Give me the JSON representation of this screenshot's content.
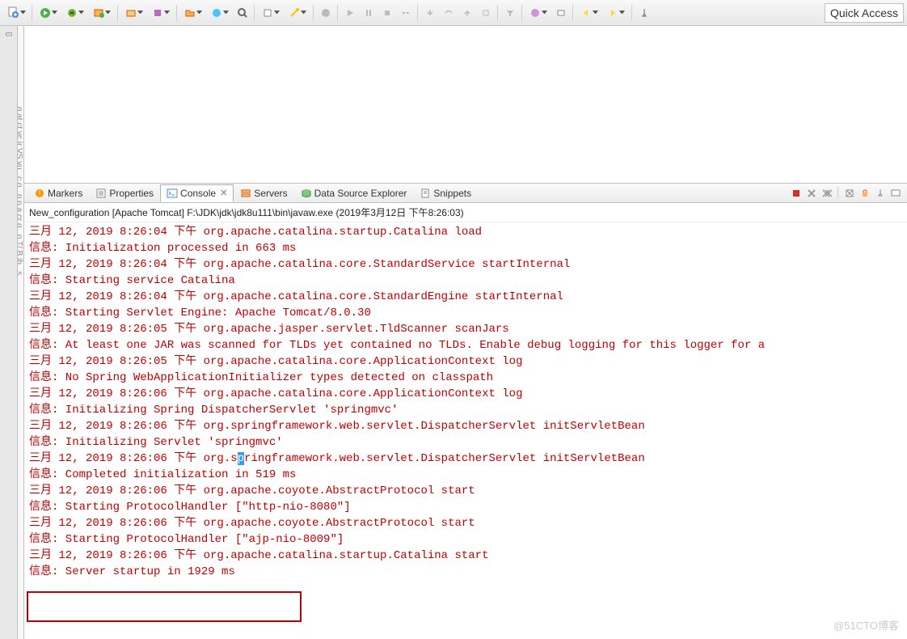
{
  "toolbar": {
    "quick_access": "Quick Access"
  },
  "tabs": {
    "markers": "Markers",
    "properties": "Properties",
    "console": "Console",
    "servers": "Servers",
    "data_source": "Data Source Explorer",
    "snippets": "Snippets"
  },
  "console": {
    "header": "New_configuration [Apache Tomcat] F:\\JDK\\jdk\\jdk8u111\\bin\\javaw.exe (2019年3月12日 下午8:26:03)",
    "lines": [
      "三月 12, 2019 8:26:04 下午 org.apache.catalina.startup.Catalina load",
      "信息: Initialization processed in 663 ms",
      "三月 12, 2019 8:26:04 下午 org.apache.catalina.core.StandardService startInternal",
      "信息: Starting service Catalina",
      "三月 12, 2019 8:26:04 下午 org.apache.catalina.core.StandardEngine startInternal",
      "信息: Starting Servlet Engine: Apache Tomcat/8.0.30",
      "三月 12, 2019 8:26:05 下午 org.apache.jasper.servlet.TldScanner scanJars",
      "信息: At least one JAR was scanned for TLDs yet contained no TLDs. Enable debug logging for this logger for a",
      "三月 12, 2019 8:26:05 下午 org.apache.catalina.core.ApplicationContext log",
      "信息: No Spring WebApplicationInitializer types detected on classpath",
      "三月 12, 2019 8:26:06 下午 org.apache.catalina.core.ApplicationContext log",
      "信息: Initializing Spring DispatcherServlet 'springmvc'",
      "三月 12, 2019 8:26:06 下午 org.springframework.web.servlet.DispatcherServlet initServletBean",
      "信息: Initializing Servlet 'springmvc'",
      "",
      "信息: Completed initialization in 519 ms",
      "三月 12, 2019 8:26:06 下午 org.apache.coyote.AbstractProtocol start",
      "信息: Starting ProtocolHandler [\"http-nio-8080\"]",
      "三月 12, 2019 8:26:06 下午 org.apache.coyote.AbstractProtocol start",
      "信息: Starting ProtocolHandler [\"ajp-nio-8009\"]",
      "三月 12, 2019 8:26:06 下午 org.apache.catalina.startup.Catalina start",
      "信息: Server startup in 1929 ms"
    ],
    "line14_pre": "三月 12, 2019 8:26:06 下午 org.s",
    "line14_sel": "p",
    "line14_post": "ringframework.web.servlet.DispatcherServlet initServletBean"
  },
  "watermark": "@51CTO博客"
}
